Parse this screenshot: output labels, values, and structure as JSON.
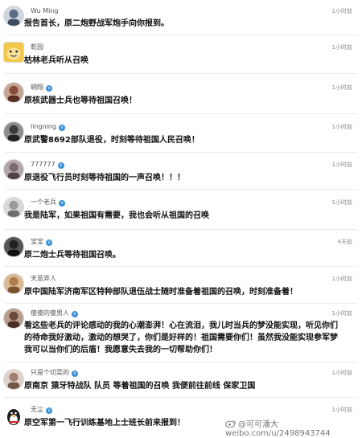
{
  "comments": [
    {
      "user": "Wu Ming",
      "verified": false,
      "time": "1小时前",
      "text": "报告首长，原二炮野战军炮手向你报到。",
      "avatar_color": "#5b6e86",
      "avatar_icon": "person-photo-icon"
    },
    {
      "user": "乾园",
      "verified": false,
      "time": "1小时前",
      "text": "枯林老兵听从召唤",
      "avatar_color": "#f2c84a",
      "avatar_icon": "cartoon-face-icon"
    },
    {
      "user": "翱翔",
      "verified": true,
      "time": "1小时前",
      "text": "原核武器士兵也等待祖国召唤！",
      "avatar_color": "#8a4a3a",
      "avatar_icon": "person-photo-icon"
    },
    {
      "user": "lingning",
      "verified": true,
      "time": "1小时前",
      "text": "原武警8692部队退役，时刻等待祖国人民召唤！",
      "avatar_color": "#3b3b3b",
      "avatar_icon": "person-photo-icon"
    },
    {
      "user": "777777",
      "verified": true,
      "time": "1小时前",
      "text": "原退役飞行员时刻等待祖国的一声召唤！！！",
      "avatar_color": "#7a6b70",
      "avatar_icon": "person-photo-icon"
    },
    {
      "user": "一个老兵",
      "verified": true,
      "time": "1小时前",
      "text": "我是陆军，如果祖国有需要，我也会听从祖国的召唤",
      "avatar_color": "#9a9a9a",
      "avatar_icon": "person-photo-icon"
    },
    {
      "user": "宝宝",
      "verified": true,
      "time": "4天前",
      "text": "原二炮士兵等待祖国召唤。",
      "avatar_color": "#222222",
      "avatar_icon": "person-photo-icon"
    },
    {
      "user": "天意弄人",
      "verified": false,
      "time": "1小时前",
      "text": "原中国陆军济南军区特种部队退伍战士随时准备着祖国的召唤，时刻准备着！",
      "avatar_color": "#b07a4a",
      "avatar_icon": "person-photo-icon"
    },
    {
      "user": "傻傻的傻男人",
      "verified": true,
      "time": "1小时前",
      "text": "看这些老兵的评论感动的我的心潮澎湃！心在流泪，我儿时当兵的梦没能实现，听见你们\n的待命我好激动，激动的想哭了，你们是好样的！祖国需要你们！虽然我没能实现参军梦\n我可以当你们的后盾！我愿意失去我的一切帮助你们！",
      "avatar_color": "#6b4a3a",
      "avatar_icon": "person-photo-icon"
    },
    {
      "user": "只是个切菜的",
      "verified": true,
      "time": "1小时前",
      "text": "原南京 猿牙特战队 队员 等着祖国的召唤 我便前往前线 保家卫国",
      "avatar_color": "#a08070",
      "avatar_icon": "person-photo-icon"
    },
    {
      "user": "无尘",
      "verified": true,
      "time": "1小时前",
      "text": "原空军第一飞行训练基地上士班长前来报到！",
      "avatar_color": "#1e1e1e",
      "avatar_icon": "qq-penguin-icon"
    }
  ],
  "watermark": {
    "text": "weibo.com/u/2498943744",
    "logo": "weibo-logo-icon",
    "handle": "@可可潘大"
  }
}
